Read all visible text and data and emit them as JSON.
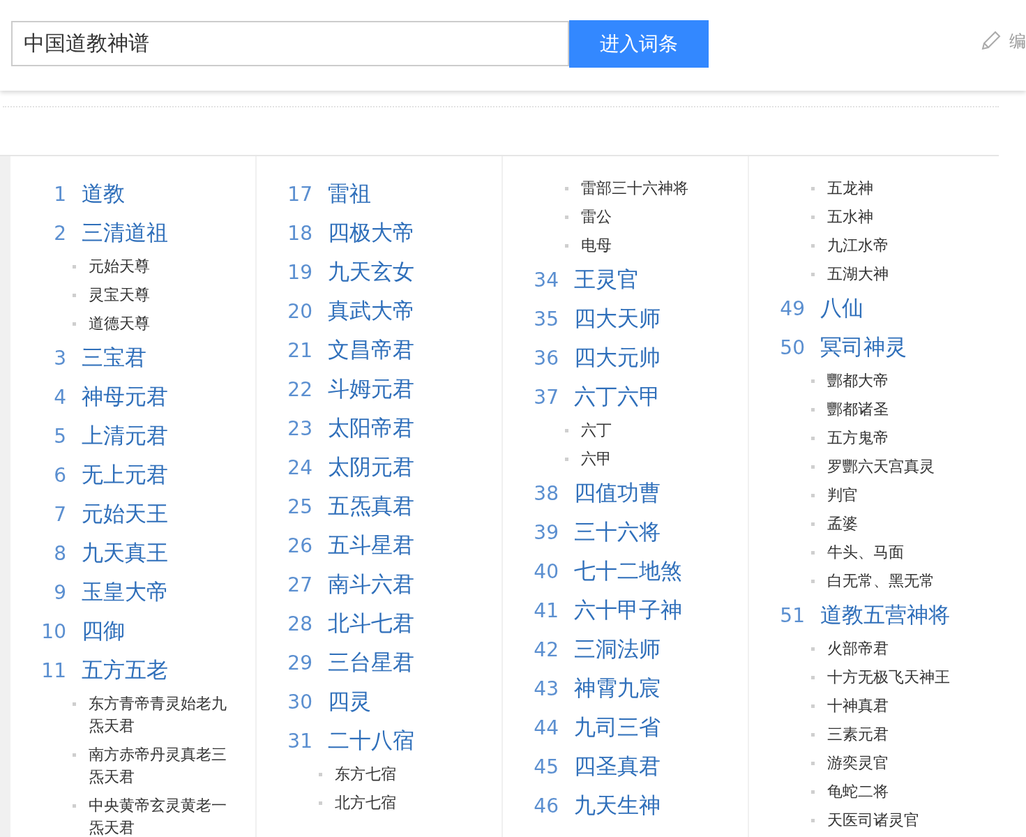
{
  "search": {
    "value": "中国道教神谱",
    "button": "进入词条"
  },
  "edit_link": "编",
  "toc_columns": [
    {
      "items": [
        {
          "number": "1",
          "title": "道教"
        },
        {
          "number": "2",
          "title": "三清道祖",
          "children": [
            "元始天尊",
            "灵宝天尊",
            "道德天尊"
          ]
        },
        {
          "number": "3",
          "title": "三宝君"
        },
        {
          "number": "4",
          "title": "神母元君"
        },
        {
          "number": "5",
          "title": "上清元君"
        },
        {
          "number": "6",
          "title": "无上元君"
        },
        {
          "number": "7",
          "title": "元始天王"
        },
        {
          "number": "8",
          "title": "九天真王"
        },
        {
          "number": "9",
          "title": "玉皇大帝"
        },
        {
          "number": "10",
          "title": "四御"
        },
        {
          "number": "11",
          "title": "五方五老",
          "children": [
            "东方青帝青灵始老九炁天君",
            "南方赤帝丹灵真老三炁天君",
            "中央黄帝玄灵黄老一炁天君"
          ]
        }
      ]
    },
    {
      "items": [
        {
          "number": "17",
          "title": "雷祖"
        },
        {
          "number": "18",
          "title": "四极大帝"
        },
        {
          "number": "19",
          "title": "九天玄女"
        },
        {
          "number": "20",
          "title": "真武大帝"
        },
        {
          "number": "21",
          "title": "文昌帝君"
        },
        {
          "number": "22",
          "title": "斗姆元君"
        },
        {
          "number": "23",
          "title": "太阳帝君"
        },
        {
          "number": "24",
          "title": "太阴元君"
        },
        {
          "number": "25",
          "title": "五炁真君"
        },
        {
          "number": "26",
          "title": "五斗星君"
        },
        {
          "number": "27",
          "title": "南斗六君"
        },
        {
          "number": "28",
          "title": "北斗七君"
        },
        {
          "number": "29",
          "title": "三台星君"
        },
        {
          "number": "30",
          "title": "四灵"
        },
        {
          "number": "31",
          "title": "二十八宿",
          "children": [
            "东方七宿",
            "北方七宿"
          ]
        }
      ]
    },
    {
      "items": [
        {
          "children": [
            "雷部三十六神将",
            "雷公",
            "电母"
          ]
        },
        {
          "number": "34",
          "title": "王灵官"
        },
        {
          "number": "35",
          "title": "四大天师"
        },
        {
          "number": "36",
          "title": "四大元帅"
        },
        {
          "number": "37",
          "title": "六丁六甲",
          "children": [
            "六丁",
            "六甲"
          ]
        },
        {
          "number": "38",
          "title": "四值功曹"
        },
        {
          "number": "39",
          "title": "三十六将"
        },
        {
          "number": "40",
          "title": "七十二地煞"
        },
        {
          "number": "41",
          "title": "六十甲子神"
        },
        {
          "number": "42",
          "title": "三洞法师"
        },
        {
          "number": "43",
          "title": "神霄九宸"
        },
        {
          "number": "44",
          "title": "九司三省"
        },
        {
          "number": "45",
          "title": "四圣真君"
        },
        {
          "number": "46",
          "title": "九天生神"
        }
      ]
    },
    {
      "items": [
        {
          "children": [
            "五龙神",
            "五水神",
            "九江水帝",
            "五湖大神"
          ]
        },
        {
          "number": "49",
          "title": "八仙"
        },
        {
          "number": "50",
          "title": "冥司神灵",
          "children": [
            "酆都大帝",
            "酆都诸圣",
            "五方鬼帝",
            "罗酆六天宫真灵",
            "判官",
            "孟婆",
            "牛头、马面",
            "白无常、黑无常"
          ]
        },
        {
          "number": "51",
          "title": "道教五营神将",
          "children": [
            "火部帝君",
            "十方无极飞天神王",
            "十神真君",
            "三素元君",
            "游奕灵官",
            "龟蛇二将",
            "天医司诸灵官"
          ]
        }
      ]
    }
  ]
}
